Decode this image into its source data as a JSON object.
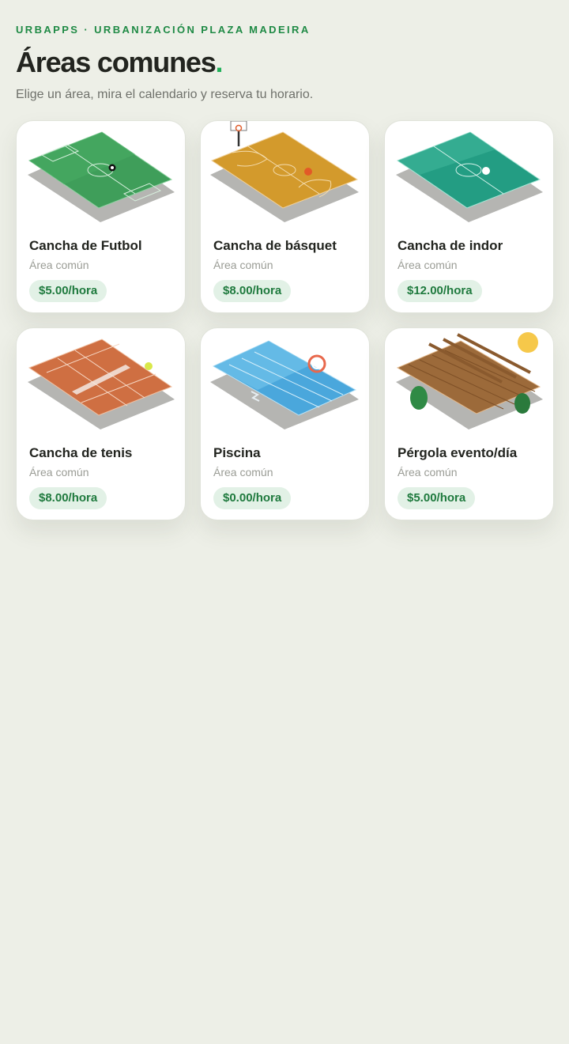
{
  "header": {
    "eyebrow": "URBAPPS · URBANIZACIÓN PLAZA MADEIRA",
    "title": "Áreas comunes",
    "title_dot": ".",
    "subtitle": "Elige un área, mira el calendario y reserva tu horario."
  },
  "areas": [
    {
      "name": "Cancha de Futbol",
      "kind": "Área común",
      "price": "$5.00/hora",
      "icon": "soccer-field-icon"
    },
    {
      "name": "Cancha de básquet",
      "kind": "Área común",
      "price": "$8.00/hora",
      "icon": "basketball-court-icon"
    },
    {
      "name": "Cancha de indor",
      "kind": "Área común",
      "price": "$12.00/hora",
      "icon": "indoor-court-icon"
    },
    {
      "name": "Cancha de tenis",
      "kind": "Área común",
      "price": "$8.00/hora",
      "icon": "tennis-court-icon"
    },
    {
      "name": "Piscina",
      "kind": "Área común",
      "price": "$0.00/hora",
      "icon": "pool-icon"
    },
    {
      "name": "Pérgola evento/día",
      "kind": "Área común",
      "price": "$5.00/hora",
      "icon": "pergola-icon"
    }
  ],
  "colors": {
    "background": "#edefe7",
    "accent": "#1f8a45",
    "price_bg": "#e2f1e6",
    "price_text": "#1f7a3e"
  }
}
